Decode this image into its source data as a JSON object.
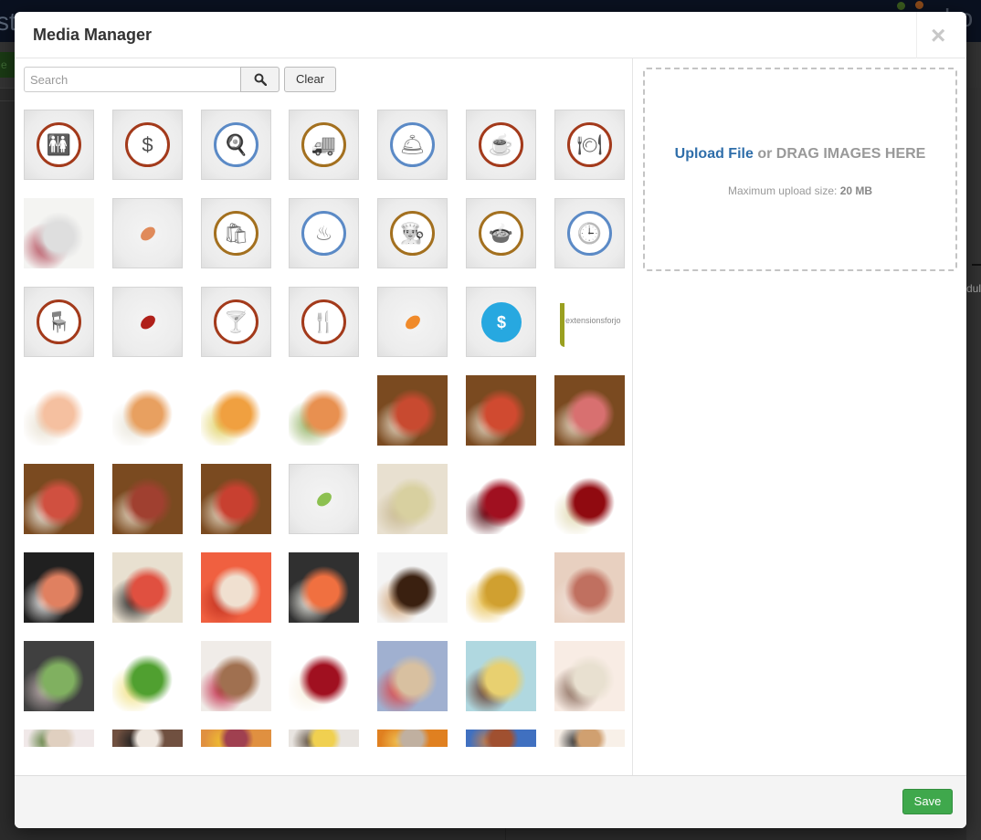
{
  "background": {
    "title_fragment": "st",
    "brand_fragment": "bo",
    "green_button_fragment": "e",
    "right_text_fragment": "dul"
  },
  "modal": {
    "title": "Media Manager",
    "close_icon": "close-icon",
    "search": {
      "placeholder": "Search",
      "value": "",
      "search_icon": "search-icon",
      "clear_label": "Clear"
    },
    "upload": {
      "link_label": "Upload File",
      "drag_text": " or DRAG IMAGES HERE",
      "max_size_label": "Maximum upload size: ",
      "max_size_value": "20 MB"
    },
    "footer": {
      "save_label": "Save"
    }
  },
  "colors": {
    "accent_blue": "#2f6eaa",
    "save_green": "#3fa84c",
    "icon_rust": "#a33a1b",
    "icon_gold": "#a3701f",
    "icon_blue": "#5b8ac6",
    "icon_cyan": "#27a8e0"
  },
  "media_items": [
    {
      "kind": "icon",
      "name": "restroom-icon",
      "glyph": "🚻",
      "color": "#a33a1b"
    },
    {
      "kind": "icon",
      "name": "payment-icon",
      "glyph": "$",
      "color": "#a33a1b"
    },
    {
      "kind": "icon",
      "name": "kitchen-tools-icon",
      "glyph": "🍳",
      "color": "#5b8ac6"
    },
    {
      "kind": "icon",
      "name": "delivery-truck-icon",
      "glyph": "🚚",
      "color": "#a3701f"
    },
    {
      "kind": "icon",
      "name": "service-bell-icon",
      "glyph": "🛎",
      "color": "#5b8ac6"
    },
    {
      "kind": "icon",
      "name": "coffee-cup-icon",
      "glyph": "☕",
      "color": "#a33a1b"
    },
    {
      "kind": "icon",
      "name": "food-cloche-icon",
      "glyph": "🍽",
      "color": "#a33a1b"
    },
    {
      "kind": "photo",
      "name": "menu-fork-photo",
      "colors": [
        "#f4f4f2",
        "#dedede",
        "#b04050"
      ]
    },
    {
      "kind": "small",
      "name": "peanut-icon",
      "glyph": "🥜",
      "color": "#e08a5a"
    },
    {
      "kind": "icon",
      "name": "takeaway-bag-icon",
      "glyph": "🛍",
      "color": "#a3701f"
    },
    {
      "kind": "icon",
      "name": "hot-dish-icon",
      "glyph": "♨",
      "color": "#5b8ac6"
    },
    {
      "kind": "icon",
      "name": "chef-hat-icon",
      "glyph": "👨‍🍳",
      "color": "#a3701f"
    },
    {
      "kind": "icon",
      "name": "soup-bowl-icon",
      "glyph": "🍲",
      "color": "#a3701f"
    },
    {
      "kind": "icon",
      "name": "clock-icon",
      "glyph": "🕒",
      "color": "#5b8ac6"
    },
    {
      "kind": "icon",
      "name": "chair-icon",
      "glyph": "🪑",
      "color": "#a33a1b"
    },
    {
      "kind": "small",
      "name": "chili-pepper-icon",
      "glyph": "🌶",
      "color": "#b0201a"
    },
    {
      "kind": "icon",
      "name": "cocktail-icon",
      "glyph": "🍸",
      "color": "#a33a1b"
    },
    {
      "kind": "icon",
      "name": "fork-knife-icon",
      "glyph": "🍴",
      "color": "#a33a1b"
    },
    {
      "kind": "small",
      "name": "carrot-icon",
      "glyph": "🥕",
      "color": "#f08a2a"
    },
    {
      "kind": "cyan",
      "name": "invoice-dollar-icon",
      "glyph": "$",
      "color": "#27a8e0"
    },
    {
      "kind": "logo",
      "name": "extensionsforjoomla-logo",
      "text": "extensionsforjo",
      "color": "#9aa020"
    },
    {
      "kind": "photo",
      "name": "sushi-roll-photo-1",
      "colors": [
        "#ffffff",
        "#f5c0a0",
        "#e8e0d0"
      ]
    },
    {
      "kind": "photo",
      "name": "sushi-roll-photo-2",
      "colors": [
        "#ffffff",
        "#e8a060",
        "#e8e4d8"
      ]
    },
    {
      "kind": "photo",
      "name": "sushi-roll-photo-3",
      "colors": [
        "#ffffff",
        "#f0a040",
        "#e0d060"
      ]
    },
    {
      "kind": "photo",
      "name": "sushi-roll-photo-4",
      "colors": [
        "#ffffff",
        "#e89050",
        "#90b060"
      ]
    },
    {
      "kind": "photo",
      "name": "pizza-photo-1",
      "colors": [
        "#7a4a20",
        "#c84a30",
        "#e8dcc8"
      ]
    },
    {
      "kind": "photo",
      "name": "pizza-photo-2",
      "colors": [
        "#7a4a20",
        "#d04a30",
        "#e8dcc8"
      ]
    },
    {
      "kind": "photo",
      "name": "pizza-photo-3",
      "colors": [
        "#7a4a20",
        "#d87070",
        "#e8dcc8"
      ]
    },
    {
      "kind": "photo",
      "name": "pizza-photo-4",
      "colors": [
        "#7a4a20",
        "#d05040",
        "#f0f0e8"
      ]
    },
    {
      "kind": "photo",
      "name": "pizza-photo-5",
      "colors": [
        "#7a4a20",
        "#a04030",
        "#e8dcc8"
      ]
    },
    {
      "kind": "photo",
      "name": "pizza-photo-6",
      "colors": [
        "#7a4a20",
        "#c84030",
        "#e8dcc8"
      ]
    },
    {
      "kind": "small",
      "name": "leaf-icon",
      "glyph": "🍃",
      "color": "#8cc050"
    },
    {
      "kind": "photo",
      "name": "white-wine-photo",
      "colors": [
        "#e8e0d0",
        "#d8d0a0",
        "#c8b890"
      ]
    },
    {
      "kind": "photo",
      "name": "red-wine-photo",
      "colors": [
        "#ffffff",
        "#a01020",
        "#500810"
      ]
    },
    {
      "kind": "photo",
      "name": "wine-glasses-photo",
      "colors": [
        "#ffffff",
        "#900a10",
        "#e0d8b0"
      ]
    },
    {
      "kind": "photo",
      "name": "sushi-platter-photo-1",
      "colors": [
        "#202020",
        "#e08060",
        "#f0f0f0"
      ]
    },
    {
      "kind": "photo",
      "name": "sushi-platter-photo-2",
      "colors": [
        "#e8e0d0",
        "#e05040",
        "#202020"
      ]
    },
    {
      "kind": "photo",
      "name": "sushi-platter-photo-3",
      "colors": [
        "#f06040",
        "#f0e0d0",
        "#c03020"
      ]
    },
    {
      "kind": "photo",
      "name": "sushi-platter-photo-4",
      "colors": [
        "#303030",
        "#f07040",
        "#f0f0e8"
      ]
    },
    {
      "kind": "photo",
      "name": "chocolate-cake-photo",
      "colors": [
        "#f4f4f4",
        "#3a2010",
        "#d0a070"
      ]
    },
    {
      "kind": "photo",
      "name": "tortellini-photo",
      "colors": [
        "#ffffff",
        "#d0a030",
        "#e8c050"
      ]
    },
    {
      "kind": "photo",
      "name": "meat-roll-photo",
      "colors": [
        "#e8d0c0",
        "#c07060",
        "#f0e0d8"
      ]
    },
    {
      "kind": "photo",
      "name": "cucumber-rolls-photo",
      "colors": [
        "#404040",
        "#80b060",
        "#c0b0b0"
      ]
    },
    {
      "kind": "photo",
      "name": "fish-salad-photo",
      "colors": [
        "#ffffff",
        "#50a030",
        "#f0e080"
      ]
    },
    {
      "kind": "photo",
      "name": "raspberry-tart-photo",
      "colors": [
        "#f0ece8",
        "#a07050",
        "#c02040"
      ]
    },
    {
      "kind": "photo",
      "name": "cheesecake-photo",
      "colors": [
        "#ffffff",
        "#a01020",
        "#f8f0e0"
      ]
    },
    {
      "kind": "photo",
      "name": "napoleon-cake-photo",
      "colors": [
        "#a0b0d0",
        "#d8c0a0",
        "#e04040"
      ]
    },
    {
      "kind": "photo",
      "name": "octopus-potato-photo",
      "colors": [
        "#b0d8e0",
        "#e8d070",
        "#603020"
      ]
    },
    {
      "kind": "photo",
      "name": "goat-cheese-photo",
      "colors": [
        "#f8ece4",
        "#e8e0d0",
        "#806050"
      ]
    },
    {
      "kind": "photo",
      "name": "partial-photo-1",
      "colors": [
        "#f0e8e8",
        "#e0d0c0",
        "#608040"
      ]
    },
    {
      "kind": "photo",
      "name": "partial-photo-2",
      "colors": [
        "#705040",
        "#f0e8e0",
        "#202020"
      ]
    },
    {
      "kind": "photo",
      "name": "partial-photo-3",
      "colors": [
        "#e09040",
        "#a04050",
        "#f0c030"
      ]
    },
    {
      "kind": "photo",
      "name": "partial-photo-4",
      "colors": [
        "#e8e4e0",
        "#f0d050",
        "#605040"
      ]
    },
    {
      "kind": "photo",
      "name": "partial-photo-5",
      "colors": [
        "#e08020",
        "#c0b0a0",
        "#f0c050"
      ]
    },
    {
      "kind": "photo",
      "name": "partial-photo-6",
      "colors": [
        "#4070c0",
        "#a05030",
        "#c08050"
      ]
    },
    {
      "kind": "photo",
      "name": "partial-photo-7",
      "colors": [
        "#f8f0e8",
        "#d0a070",
        "#303030"
      ]
    }
  ]
}
